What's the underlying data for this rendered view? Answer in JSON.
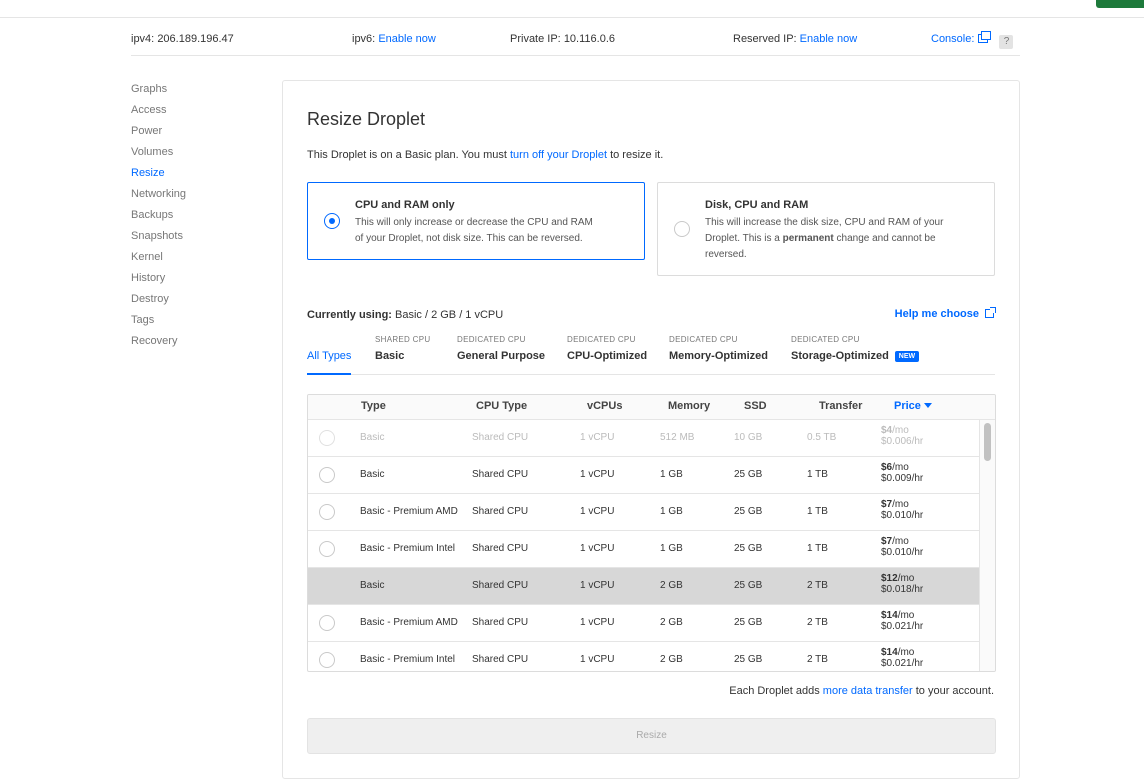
{
  "ip_bar": {
    "ipv4_label": "ipv4:",
    "ipv4_value": "206.189.196.47",
    "ipv6_label": "ipv6:",
    "ipv6_link": "Enable now",
    "private_label": "Private IP:",
    "private_value": "10.116.0.6",
    "reserved_label": "Reserved IP:",
    "reserved_link": "Enable now",
    "console_label": "Console:",
    "help_mark": "?"
  },
  "sidebar": {
    "items": [
      {
        "label": "Graphs"
      },
      {
        "label": "Access"
      },
      {
        "label": "Power"
      },
      {
        "label": "Volumes"
      },
      {
        "label": "Resize"
      },
      {
        "label": "Networking"
      },
      {
        "label": "Backups"
      },
      {
        "label": "Snapshots"
      },
      {
        "label": "Kernel"
      },
      {
        "label": "History"
      },
      {
        "label": "Destroy"
      },
      {
        "label": "Tags"
      },
      {
        "label": "Recovery"
      }
    ],
    "active": "Resize"
  },
  "panel": {
    "title": "Resize Droplet",
    "intro_prefix": "This Droplet is on a Basic plan. You must ",
    "intro_link": "turn off your Droplet",
    "intro_suffix": " to resize it.",
    "option_cpu": {
      "title": "CPU and RAM only",
      "desc_line1": "This will only increase or decrease the CPU and RAM",
      "desc_line2": "of your Droplet, not disk size. This can be reversed."
    },
    "option_disk": {
      "title": "Disk, CPU and RAM",
      "desc_line1": "This will increase the disk size, CPU and RAM of your",
      "desc_line2_prefix": "Droplet. This is a ",
      "desc_line2_bold": "permanent",
      "desc_line2_suffix": " change and cannot be",
      "desc_line3": "reversed."
    },
    "current_label": "Currently using:",
    "current_value": " Basic / 2 GB / 1 vCPU",
    "help_link": "Help me choose"
  },
  "tabs": [
    {
      "sup": "",
      "name": "All Types"
    },
    {
      "sup": "SHARED CPU",
      "name": "Basic"
    },
    {
      "sup": "DEDICATED CPU",
      "name": "General Purpose"
    },
    {
      "sup": "DEDICATED CPU",
      "name": "CPU-Optimized"
    },
    {
      "sup": "DEDICATED CPU",
      "name": "Memory-Optimized"
    },
    {
      "sup": "DEDICATED CPU",
      "name": "Storage-Optimized",
      "badge": "NEW"
    }
  ],
  "table": {
    "headers": {
      "type": "Type",
      "cpu": "CPU Type",
      "vcpus": "vCPUs",
      "memory": "Memory",
      "ssd": "SSD",
      "transfer": "Transfer",
      "price": "Price"
    },
    "rows": [
      {
        "type": "Basic",
        "cpu": "Shared CPU",
        "vcpus": "1 vCPU",
        "memory": "512 MB",
        "ssd": "10 GB",
        "transfer": "0.5 TB",
        "price_amt": "$4",
        "price_unit": "/mo",
        "hourly": "$0.006/hr",
        "state": "disabled"
      },
      {
        "type": "Basic",
        "cpu": "Shared CPU",
        "vcpus": "1 vCPU",
        "memory": "1 GB",
        "ssd": "25 GB",
        "transfer": "1 TB",
        "price_amt": "$6",
        "price_unit": "/mo",
        "hourly": "$0.009/hr",
        "state": "normal"
      },
      {
        "type": "Basic - Premium AMD",
        "cpu": "Shared CPU",
        "vcpus": "1 vCPU",
        "memory": "1 GB",
        "ssd": "25 GB",
        "transfer": "1 TB",
        "price_amt": "$7",
        "price_unit": "/mo",
        "hourly": "$0.010/hr",
        "state": "normal"
      },
      {
        "type": "Basic - Premium Intel",
        "cpu": "Shared CPU",
        "vcpus": "1 vCPU",
        "memory": "1 GB",
        "ssd": "25 GB",
        "transfer": "1 TB",
        "price_amt": "$7",
        "price_unit": "/mo",
        "hourly": "$0.010/hr",
        "state": "normal"
      },
      {
        "type": "Basic",
        "cpu": "Shared CPU",
        "vcpus": "1 vCPU",
        "memory": "2 GB",
        "ssd": "25 GB",
        "transfer": "2 TB",
        "price_amt": "$12",
        "price_unit": "/mo",
        "hourly": "$0.018/hr",
        "state": "selected"
      },
      {
        "type": "Basic - Premium AMD",
        "cpu": "Shared CPU",
        "vcpus": "1 vCPU",
        "memory": "2 GB",
        "ssd": "25 GB",
        "transfer": "2 TB",
        "price_amt": "$14",
        "price_unit": "/mo",
        "hourly": "$0.021/hr",
        "state": "normal"
      },
      {
        "type": "Basic - Premium Intel",
        "cpu": "Shared CPU",
        "vcpus": "1 vCPU",
        "memory": "2 GB",
        "ssd": "25 GB",
        "transfer": "2 TB",
        "price_amt": "$14",
        "price_unit": "/mo",
        "hourly": "$0.021/hr",
        "state": "normal"
      }
    ]
  },
  "footer": {
    "note_prefix": "Each Droplet adds ",
    "note_link": "more data transfer",
    "note_suffix": " to your account.",
    "resize_button": "Resize"
  },
  "colors": {
    "accent": "#0069ff",
    "brand_green": "#1e7a3b",
    "selected_row": "#d7d7d7"
  },
  "icons": [
    "console-external-icon",
    "external-link-icon",
    "sort-caret-down-icon",
    "radio-icon"
  ]
}
